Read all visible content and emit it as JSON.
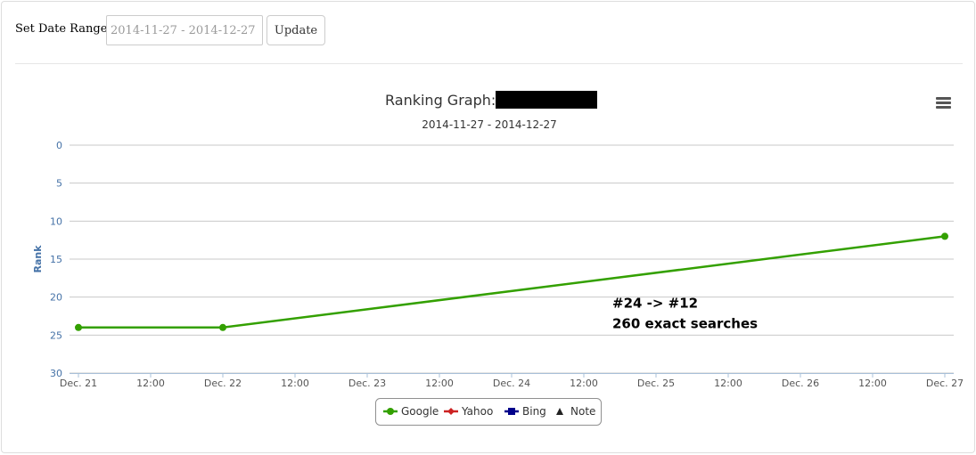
{
  "toolbar": {
    "date_range_label": "Set Date Range :",
    "date_range_value": "2014-11-27 - 2014-12-27",
    "update_label": "Update"
  },
  "chart_data": {
    "type": "line",
    "title": "Ranking Graph:",
    "subtitle": "2014-11-27 - 2014-12-27",
    "ylabel": "Rank",
    "xlabel": "",
    "y_reversed": true,
    "ylim": [
      0,
      30
    ],
    "y_ticks": [
      0,
      5,
      10,
      15,
      20,
      25,
      30
    ],
    "x_range": [
      "2014-12-21",
      "2014-12-27"
    ],
    "x_tick_labels": [
      "Dec. 21",
      "12:00",
      "Dec. 22",
      "12:00",
      "Dec. 23",
      "12:00",
      "Dec. 24",
      "12:00",
      "Dec. 25",
      "12:00",
      "Dec. 26",
      "12:00",
      "Dec. 27"
    ],
    "grid": true,
    "legend_position": "bottom-center",
    "series": [
      {
        "name": "Google",
        "color": "#33a000",
        "marker": "circle",
        "points": [
          {
            "x": "2014-12-21",
            "y": 24
          },
          {
            "x": "2014-12-22",
            "y": 24
          },
          {
            "x": "2014-12-27",
            "y": 12
          }
        ]
      },
      {
        "name": "Yahoo",
        "color": "#cc2222",
        "marker": "diamond",
        "points": []
      },
      {
        "name": "Bing",
        "color": "#00008b",
        "marker": "square",
        "points": []
      },
      {
        "name": "Note",
        "color": "#222222",
        "marker": "triangle",
        "points": []
      }
    ],
    "annotations": [
      {
        "lines": [
          "#24 -> #12",
          "260 exact searches"
        ],
        "x": "2014-12-25",
        "y": 21.5
      }
    ],
    "colors": {
      "axis_label": "#4572a7",
      "grid": "#c8c8c8",
      "tick_text": "#555555"
    }
  }
}
